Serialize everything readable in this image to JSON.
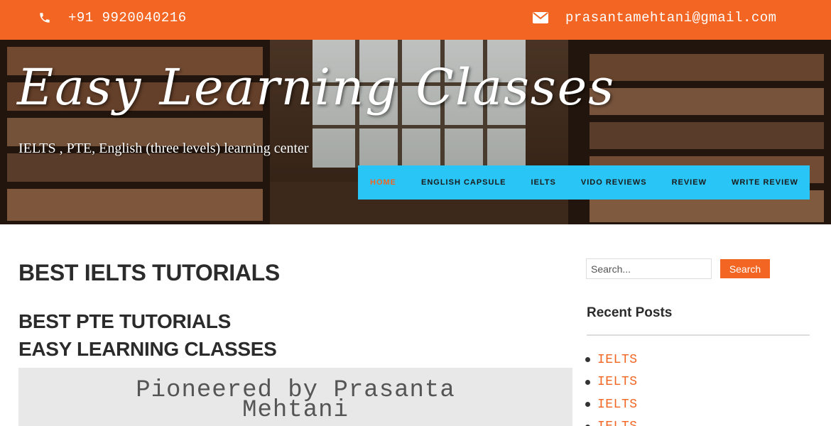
{
  "topbar": {
    "phone_icon": "phone-icon",
    "phone": "+91 9920040216",
    "email_icon": "envelope-icon",
    "email": "prasantamehtani@gmail.com",
    "color": "#f26522"
  },
  "header": {
    "site_title": "Easy Learning Classes",
    "tagline": "IELTS , PTE, English (three levels) learning center",
    "background": "library-photo"
  },
  "nav": {
    "color": "#29c5f6",
    "items": [
      {
        "label": "HOME",
        "active": true
      },
      {
        "label": "ENGLISH CAPSULE"
      },
      {
        "label": "IELTS"
      },
      {
        "label": "VIDO REVIEWS"
      },
      {
        "label": "REVIEW"
      },
      {
        "label": "WRITE REVIEW"
      }
    ]
  },
  "main": {
    "heading1": "BEST IELTS TUTORIALS",
    "heading2_line1": "BEST PTE TUTORIALS",
    "heading2_line2": "EASY LEARNING CLASSES",
    "pioneer_text": "Pioneered by Prasanta Mehtani"
  },
  "sidebar": {
    "search_placeholder": "Search...",
    "search_button": "Search",
    "recent_title": "Recent Posts",
    "posts": [
      "IELTS",
      "IELTS",
      "IELTS",
      "IELTS"
    ]
  }
}
